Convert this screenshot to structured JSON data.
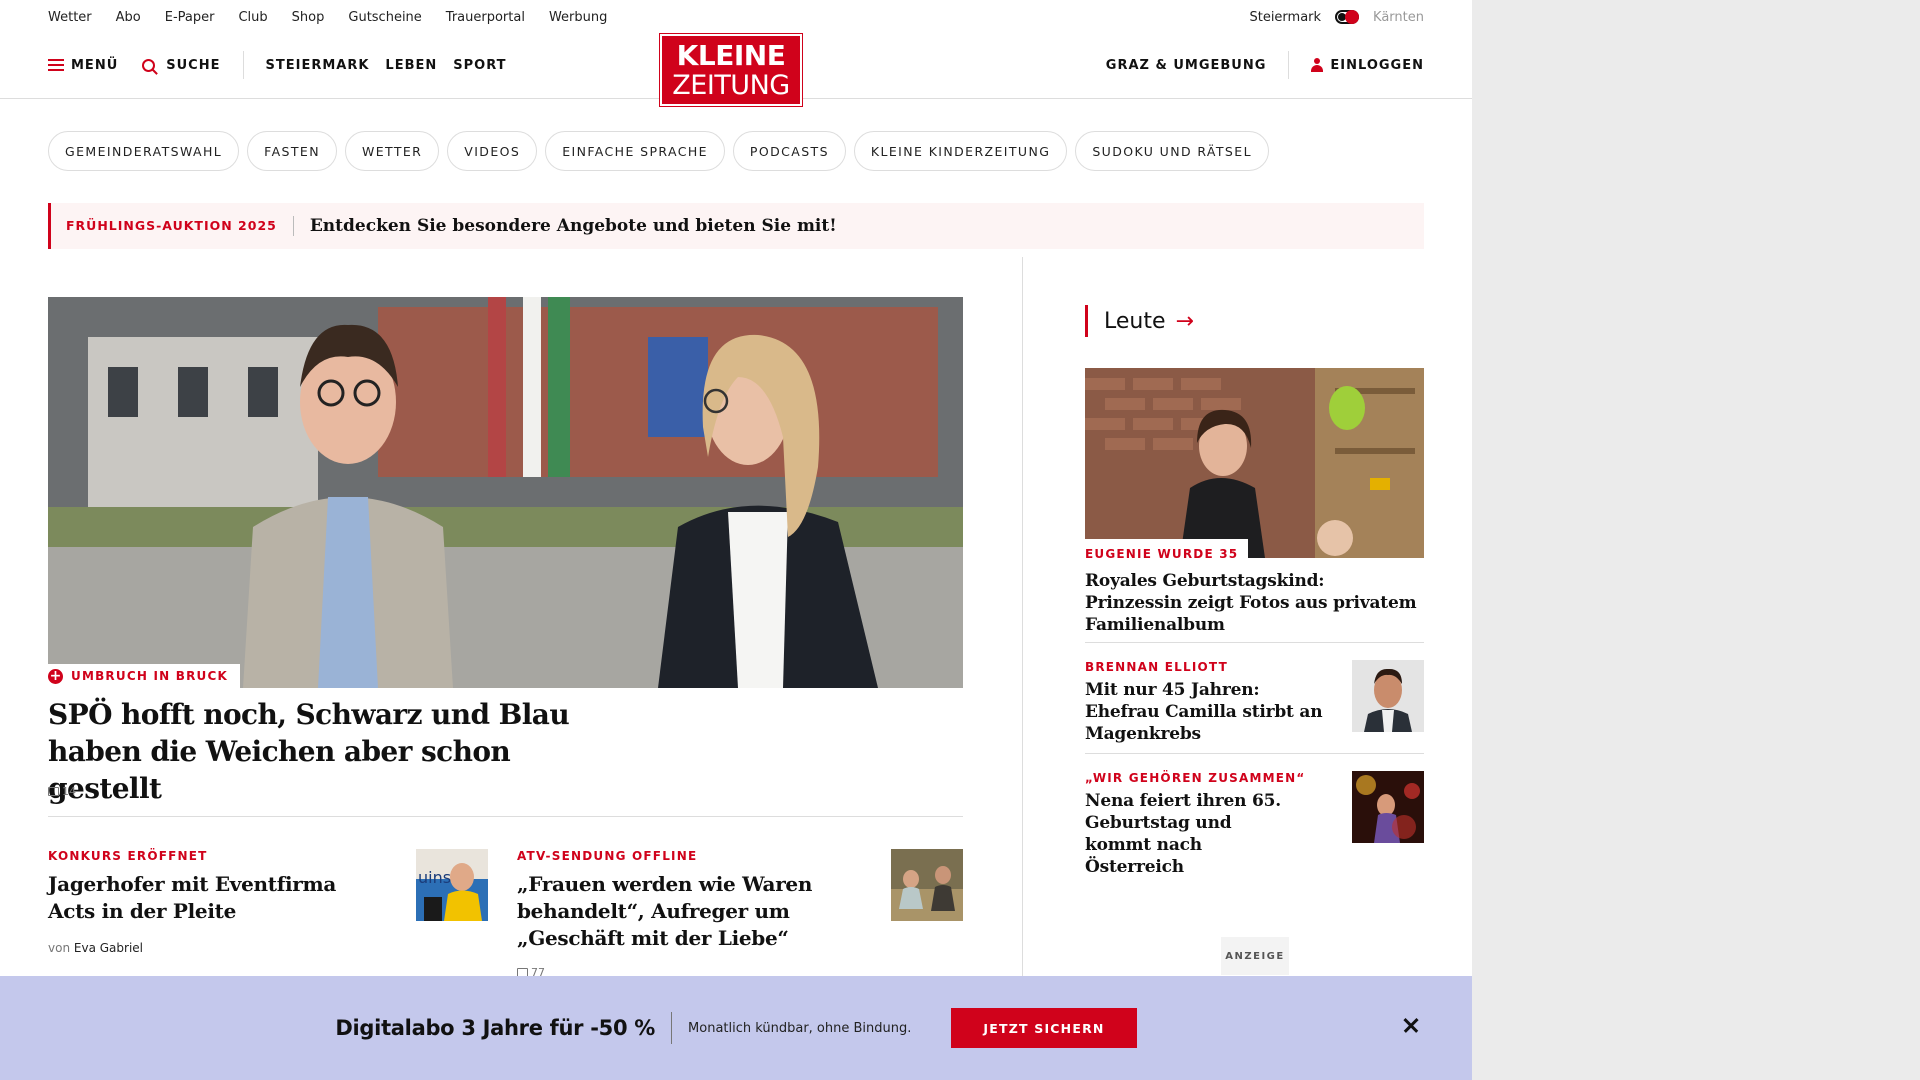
{
  "topbar": {
    "links": [
      "Wetter",
      "Abo",
      "E-Paper",
      "Club",
      "Shop",
      "Gutscheine",
      "Trauerportal",
      "Werbung"
    ],
    "region_active": "Steiermark",
    "region_inactive": "Kärnten"
  },
  "header": {
    "menu_label": "MENÜ",
    "search_label": "SUCHE",
    "nav": [
      "STEIERMARK",
      "LEBEN",
      "SPORT"
    ],
    "logo_line1": "KLEINE",
    "logo_line2": "ZEITUNG",
    "region_link": "GRAZ & UMGEBUNG",
    "login_label": "EINLOGGEN",
    "brand_color": "#d0021b"
  },
  "pills": [
    "GEMEINDERATSWAHL",
    "FASTEN",
    "WETTER",
    "VIDEOS",
    "EINFACHE SPRACHE",
    "PODCASTS",
    "KLEINE KINDERZEITUNG",
    "SUDOKU UND RÄTSEL"
  ],
  "promo": {
    "tag": "FRÜHLINGS-AUKTION 2025",
    "text": "Entdecken Sie besondere Angebote und bieten Sie mit!"
  },
  "lead": {
    "kicker": "UMBRUCH IN BRUCK",
    "title": "SPÖ hofft noch, Schwarz und Blau haben die Weichen aber schon gestellt",
    "comments": "14"
  },
  "subs": [
    {
      "kicker": "KONKURS ERÖFFNET",
      "title": "Jagerhofer mit Eventfirma Acts in der Pleite",
      "byline_prefix": "von",
      "author": "Eva Gabriel"
    },
    {
      "kicker": "ATV-SENDUNG OFFLINE",
      "title": "„Frauen werden wie Waren behandelt“, Aufreger um „Geschäft mit der Liebe“",
      "comments": "77"
    }
  ],
  "sidebar": {
    "section_title": "Leute",
    "items": [
      {
        "kicker": "EUGENIE WURDE 35",
        "title": "Royales Geburtstagskind: Prinzessin zeigt Fotos aus privatem Familienalbum"
      },
      {
        "kicker": "BRENNAN ELLIOTT",
        "title": "Mit nur 45 Jahren: Ehefrau Camilla stirbt an Magenkrebs"
      },
      {
        "kicker": "„WIR GEHÖREN ZUSAMMEN“",
        "title": "Nena feiert ihren 65. Geburtstag und kommt nach Österreich"
      }
    ],
    "ad_label": "ANZEIGE"
  },
  "abo": {
    "headline": "Digitalabo 3 Jahre für -50 %",
    "subtext": "Monatlich kündbar, ohne Bindung.",
    "cta": "JETZT SICHERN"
  }
}
